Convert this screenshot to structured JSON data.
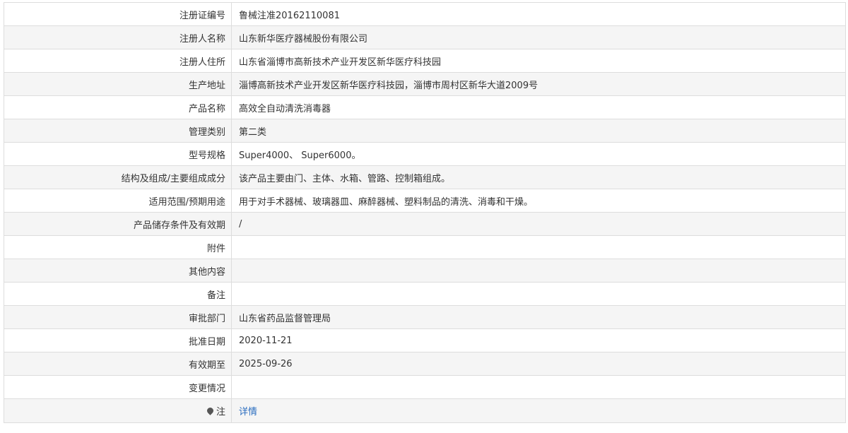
{
  "rows": [
    {
      "label": "注册证编号",
      "value": "鲁械注准20162110081"
    },
    {
      "label": "注册人名称",
      "value": "山东新华医疗器械股份有限公司"
    },
    {
      "label": "注册人住所",
      "value": "山东省淄博市高新技术产业开发区新华医疗科技园"
    },
    {
      "label": "生产地址",
      "value": "淄博高新技术产业开发区新华医疗科技园，淄博市周村区新华大道2009号"
    },
    {
      "label": "产品名称",
      "value": "高效全自动清洗消毒器"
    },
    {
      "label": "管理类别",
      "value": "第二类"
    },
    {
      "label": "型号规格",
      "value": "Super4000、 Super6000。"
    },
    {
      "label": "结构及组成/主要组成成分",
      "value": "该产品主要由门、主体、水箱、管路、控制箱组成。"
    },
    {
      "label": "适用范围/预期用途",
      "value": "用于对手术器械、玻璃器皿、麻醉器械、塑料制品的清洗、消毒和干燥。"
    },
    {
      "label": "产品储存条件及有效期",
      "value": "/"
    },
    {
      "label": "附件",
      "value": ""
    },
    {
      "label": "其他内容",
      "value": ""
    },
    {
      "label": "备注",
      "value": ""
    },
    {
      "label": "审批部门",
      "value": "山东省药品监督管理局"
    },
    {
      "label": "批准日期",
      "value": "2020-11-21"
    },
    {
      "label": "有效期至",
      "value": "2025-09-26"
    },
    {
      "label": "变更情况",
      "value": ""
    }
  ],
  "note_row": {
    "label": "注",
    "icon": "pin-icon",
    "link_text": "详情"
  },
  "colors": {
    "link": "#2a6dc0",
    "border": "#dddddd",
    "stripe": "#f5f5f5"
  }
}
